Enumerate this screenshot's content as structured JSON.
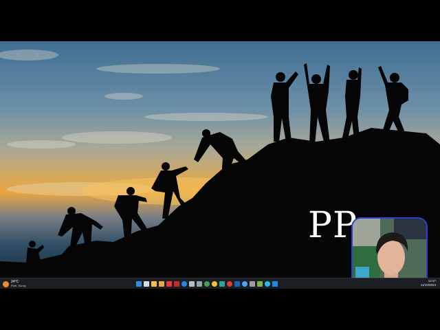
{
  "desktop": {
    "overlay_text": "PP"
  },
  "taskbar": {
    "weather": {
      "temperature": "24°C",
      "condition": "Partl. Sunny",
      "icon": "sun-icon"
    },
    "icons": [
      {
        "name": "start-icon",
        "color": "#2f8de4"
      },
      {
        "name": "search-icon",
        "color": "#d8dbe0"
      },
      {
        "name": "file-explorer-icon",
        "color": "#f2c14e"
      },
      {
        "name": "folder-icon",
        "color": "#e4a93a"
      },
      {
        "name": "youtube-icon",
        "color": "#e53935"
      },
      {
        "name": "app-icon",
        "color": "#c62828"
      },
      {
        "name": "edge-icon",
        "color": "#1e88e5"
      },
      {
        "name": "notepad-icon",
        "color": "#b0bec5"
      },
      {
        "name": "calculator-icon",
        "color": "#90a4ae"
      },
      {
        "name": "chrome-icon",
        "color": "#43a047"
      },
      {
        "name": "chrome-icon-2",
        "color": "#fbc02d"
      },
      {
        "name": "store-icon",
        "color": "#26a69a"
      },
      {
        "name": "chrome-icon-3",
        "color": "#e53935"
      },
      {
        "name": "photoshop-icon",
        "color": "#1565c0"
      },
      {
        "name": "browser-icon",
        "color": "#42a5f5"
      },
      {
        "name": "settings-icon",
        "color": "#9e9e9e"
      },
      {
        "name": "app-icon-2",
        "color": "#7cb342"
      },
      {
        "name": "edge-icon-2",
        "color": "#29b6f6"
      },
      {
        "name": "terminal-icon",
        "color": "#1e88e5"
      }
    ],
    "tray": {
      "time": "12:47",
      "date": "11/10/2024"
    }
  }
}
